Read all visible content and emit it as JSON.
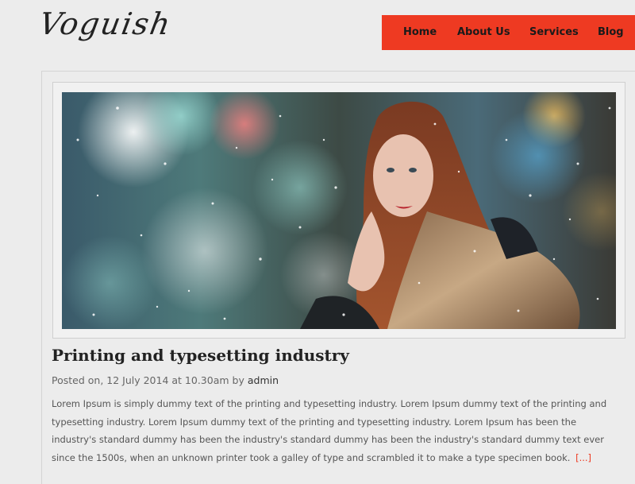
{
  "site": {
    "logo": "Voguish"
  },
  "nav": {
    "items": [
      {
        "label": "Home"
      },
      {
        "label": "About Us"
      },
      {
        "label": "Services"
      },
      {
        "label": "Blog"
      }
    ],
    "accent_color": "#ee3a22"
  },
  "post": {
    "title": "Printing and typesetting industry",
    "meta_prefix": "Posted on, 12 July 2014 at 10.30am by",
    "author": "admin",
    "excerpt": "Lorem Ipsum is simply dummy text of the printing and typesetting industry. Lorem Ipsum dummy text of the printing and typesetting industry. Lorem Ipsum dummy text of the printing and typesetting industry. Lorem Ipsum has been the industry's standard dummy has been the industry's standard dummy has been the industry's standard dummy text ever since the 1500s, when an unknown printer took a galley of type and scrambled it to make a type specimen book.",
    "read_more": "[...]",
    "image_alt": "woman-in-snow-photo"
  }
}
